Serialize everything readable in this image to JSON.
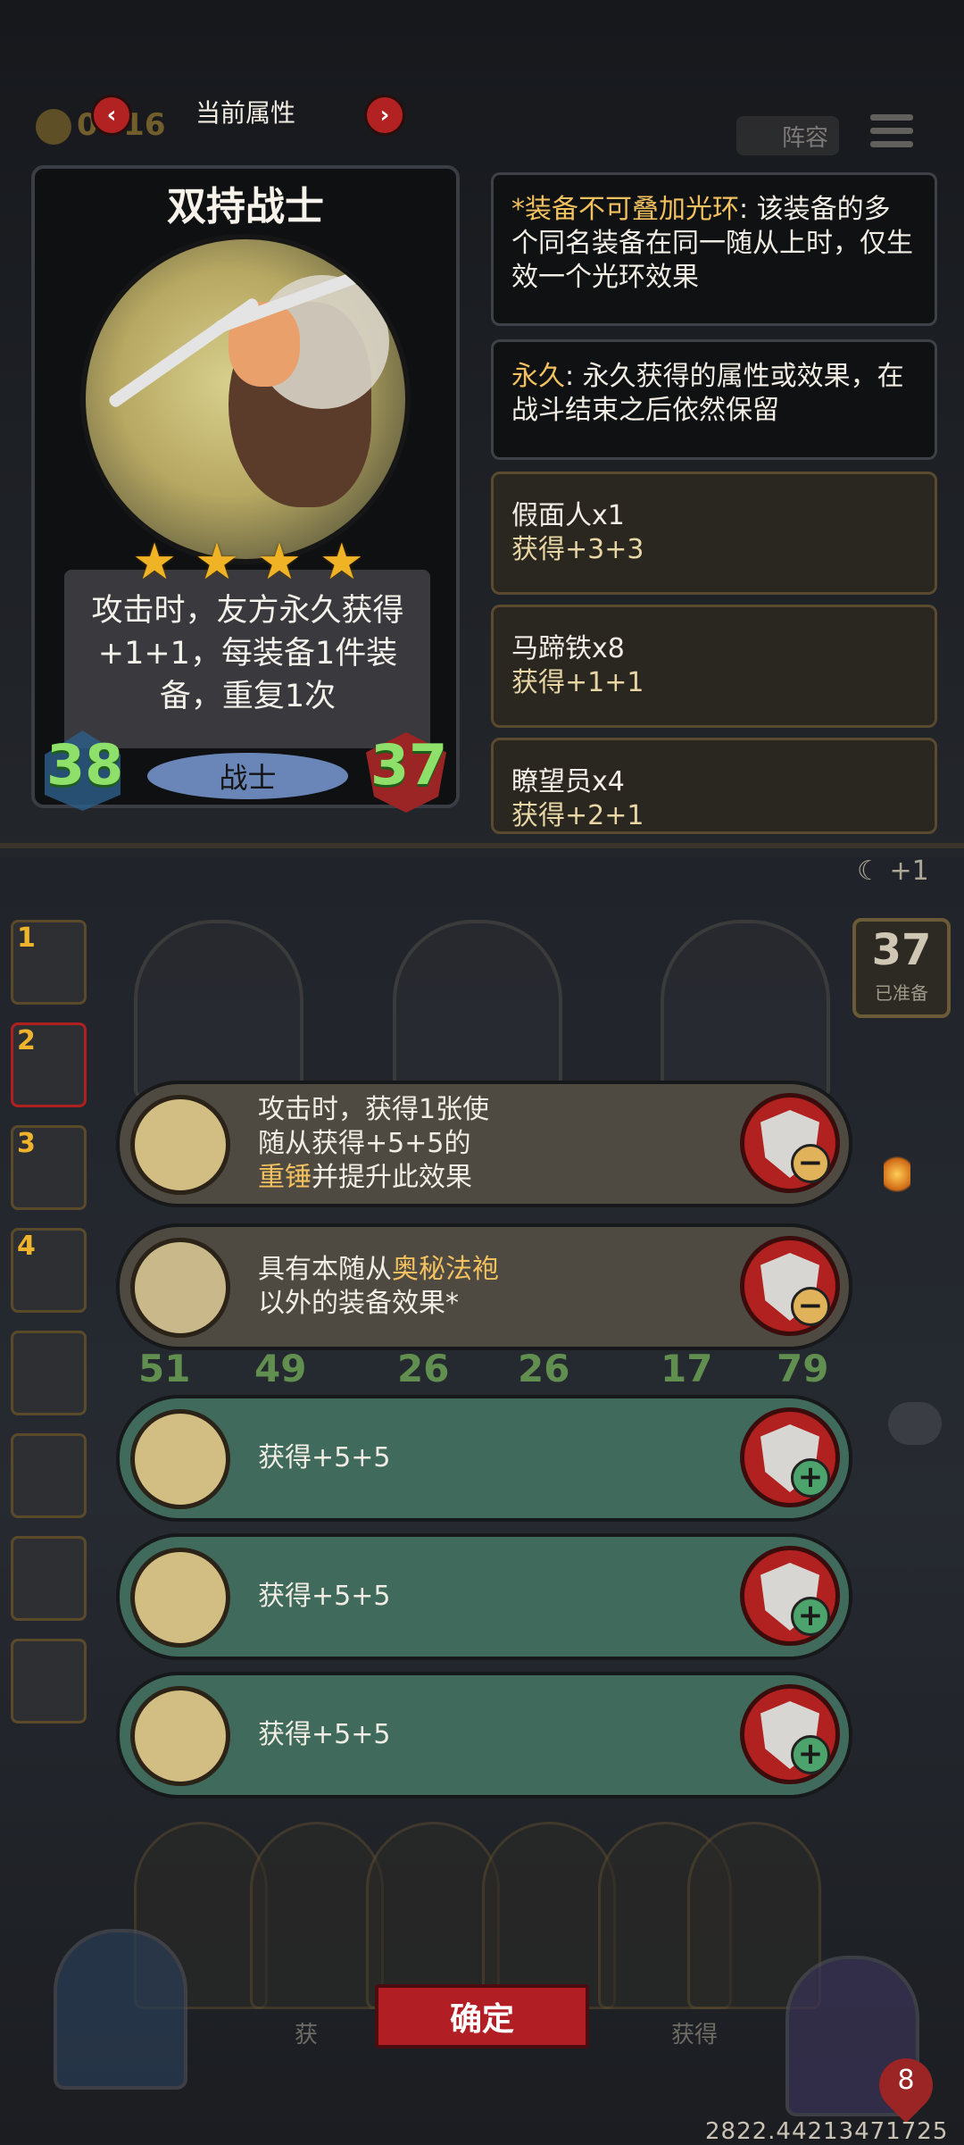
{
  "header": {
    "gold": "0",
    "gold_income": "+16",
    "title": "当前属性",
    "prev_arrow": "‹",
    "next_arrow": "›",
    "lineup_label": "阵容"
  },
  "hero_card": {
    "name": "双持战士",
    "stars": 4,
    "description": "攻击时，友方永久获得+1+1，每装备1件装备，重复1次",
    "attack": "38",
    "health": "37",
    "class": "战士",
    "star_glyph": "★"
  },
  "info_panels": [
    {
      "keyword": "*装备不可叠加光环",
      "text": ": 该装备的多个同名装备在同一随从上时，仅生效一个光环效果"
    },
    {
      "keyword": "永久",
      "text": ": 永久获得的属性或效果，在战斗结束之后依然保留"
    }
  ],
  "item_panels": [
    {
      "name": "假面人x1",
      "gain": "获得+3+3"
    },
    {
      "name": "马蹄铁x8",
      "gain": "获得+1+1"
    },
    {
      "name": "瞭望员x4",
      "gain": "获得+2+1"
    }
  ],
  "board": {
    "moon_label": "+1",
    "round_number": "37",
    "round_sub": "已准备",
    "slot_numbers": [
      "1",
      "2",
      "3",
      "4"
    ],
    "board_numbers": [
      "51",
      "49",
      "26",
      "26",
      "17",
      "79"
    ]
  },
  "options": [
    {
      "state": "owned",
      "line1": "攻击时，获得1张使",
      "line2": "随从获得+5+5的",
      "hl": "重锤",
      "line3_rest": "并提升此效果",
      "button": "remove",
      "mark": "−"
    },
    {
      "state": "owned",
      "line1_pre": "具有本随从",
      "hl": "奥秘法袍",
      "line2": "以外的装备效果*",
      "button": "remove",
      "mark": "−"
    },
    {
      "state": "available",
      "line1": "获得+5+5",
      "button": "add",
      "mark": "+"
    },
    {
      "state": "available",
      "line1": "获得+5+5",
      "button": "add",
      "mark": "+"
    },
    {
      "state": "available",
      "line1": "获得+5+5",
      "button": "add",
      "mark": "+"
    }
  ],
  "confirm_label": "确定",
  "hand_labels": [
    "获",
    "获得"
  ],
  "player_life": "8",
  "footer_code": "2822.44213471725",
  "colors": {
    "highlight": "#f2c15f",
    "stat_green": "#8ee06a",
    "confirm_red": "#b11e24",
    "option_available": "#3f6a5c",
    "option_owned": "#4e4941"
  }
}
